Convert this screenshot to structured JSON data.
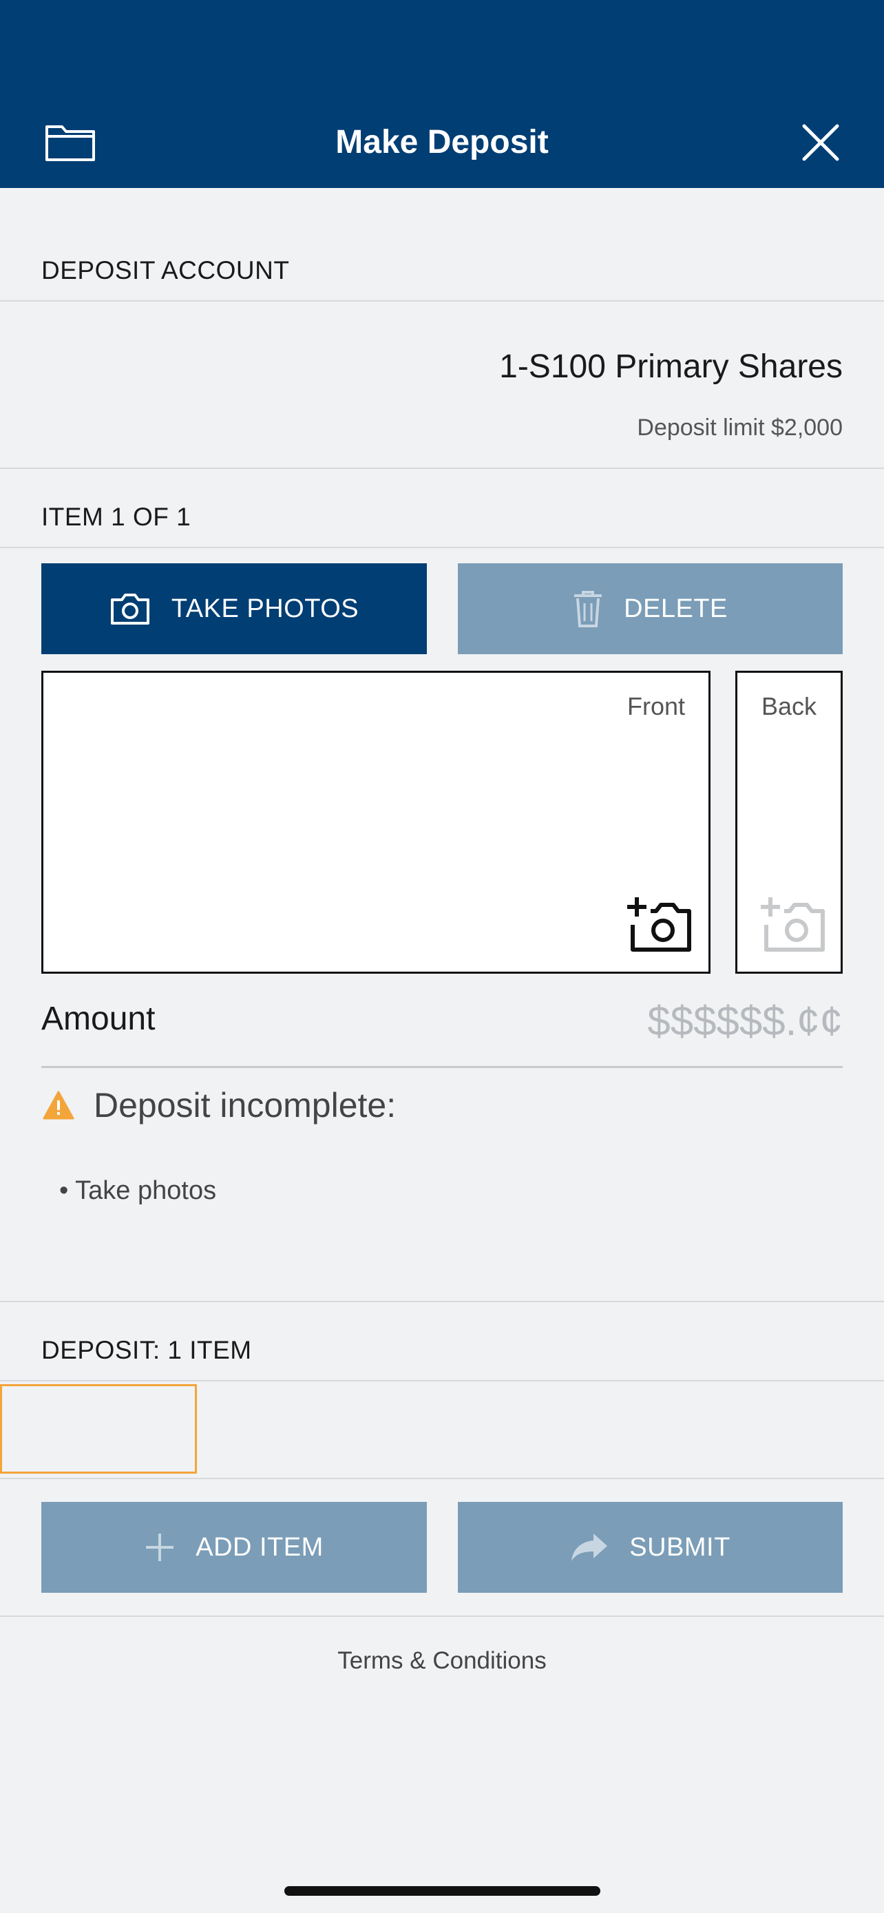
{
  "header": {
    "title": "Make Deposit"
  },
  "deposit_account": {
    "label": "DEPOSIT ACCOUNT",
    "account_name": "1-S100 Primary Shares",
    "limit": "Deposit limit $2,000"
  },
  "item": {
    "label": "ITEM 1 OF 1",
    "take_photos": "TAKE PHOTOS",
    "delete": "DELETE",
    "front_label": "Front",
    "back_label": "Back"
  },
  "amount": {
    "label": "Amount",
    "placeholder": "$$$$$$.¢¢"
  },
  "status": {
    "title": "Deposit incomplete:",
    "todo": "• Take photos"
  },
  "deposit_summary": {
    "label": "DEPOSIT: 1 ITEM"
  },
  "actions": {
    "add_item": "ADD ITEM",
    "submit": "SUBMIT"
  },
  "footer": {
    "terms": "Terms & Conditions"
  },
  "colors": {
    "header": "#003e74",
    "primary_button": "#003e74",
    "disabled_button": "#7b9db7",
    "warning": "#f3a53a"
  },
  "icons": [
    "folder-icon",
    "close-icon",
    "camera-icon",
    "trash-icon",
    "add-photo-icon",
    "warning-icon",
    "plus-icon",
    "share-arrow-icon"
  ]
}
